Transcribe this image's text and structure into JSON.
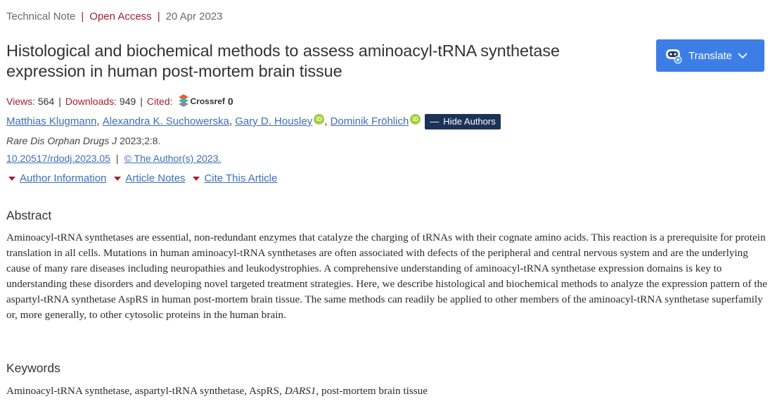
{
  "meta": {
    "article_type": "Technical Note",
    "separator": "|",
    "access": "Open Access",
    "date": "20 Apr 2023"
  },
  "title": "Histological and biochemical methods to assess aminoacyl-tRNA synthetase expression in human post-mortem brain tissue",
  "translate": {
    "label": "Translate"
  },
  "stats": {
    "views_label": "Views:",
    "views_value": "564",
    "downloads_label": "Downloads:",
    "downloads_value": "949",
    "cited_label": "Cited:",
    "crossref_label": "Crossref",
    "crossref_count": "0",
    "pipe": "|"
  },
  "authors": {
    "list": [
      {
        "name": "Matthias Klugmann",
        "orcid": false
      },
      {
        "name": "Alexandra K. Suchowerska",
        "orcid": false
      },
      {
        "name": "Gary D. Housley",
        "orcid": true
      },
      {
        "name": "Dominik Fröhlich",
        "orcid": true
      }
    ],
    "hide_label": "Hide Authors",
    "orcid_text": "iD"
  },
  "journal": {
    "name": "Rare Dis Orphan Drugs J",
    "citation": "2023;2:8."
  },
  "doi": {
    "doi": "10.20517/rdodj.2023.05",
    "license": "© The Author(s) 2023."
  },
  "toggles": {
    "author_info": "Author Information",
    "article_notes": "Article Notes",
    "cite": "Cite This Article"
  },
  "abstract": {
    "heading": "Abstract",
    "text": "Aminoacyl-tRNA synthetases are essential, non-redundant enzymes that catalyze the charging of tRNAs with their cognate amino acids. This reaction is a prerequisite for protein translation in all cells. Mutations in human aminoacyl-tRNA synthetases are often associated with defects of the peripheral and central nervous system and are the underlying cause of many rare diseases including neuropathies and leukodystrophies. A comprehensive understanding of aminoacyl-tRNA synthetase expression domains is key to understanding these disorders and developing novel targeted treatment strategies. Here, we describe histological and biochemical methods to analyze the expression pattern of the aspartyl-tRNA synthetase AspRS in human post-mortem brain tissue. The same methods can readily be applied to other members of the aminoacyl-tRNA synthetase superfamily or, more generally, to other cytosolic proteins in the human brain."
  },
  "keywords": {
    "heading": "Keywords",
    "part1": "Aminoacyl-tRNA synthetase, aspartyl-tRNA synthetase, AspRS, ",
    "italic": "DARS1",
    "part2": ", post-mortem brain tissue"
  },
  "colors": {
    "accent_red": "#a31f34",
    "link_blue": "#3c6fb8",
    "button_blue": "#3d7ee6",
    "navy": "#1d3257",
    "orcid_green": "#a6ce39"
  },
  "icons": {
    "translate": "chatbot-icon",
    "dropdown": "chevron-down-icon",
    "crossref": "crossref-logo-icon",
    "orcid": "orcid-icon",
    "toggle": "triangle-down-icon"
  }
}
